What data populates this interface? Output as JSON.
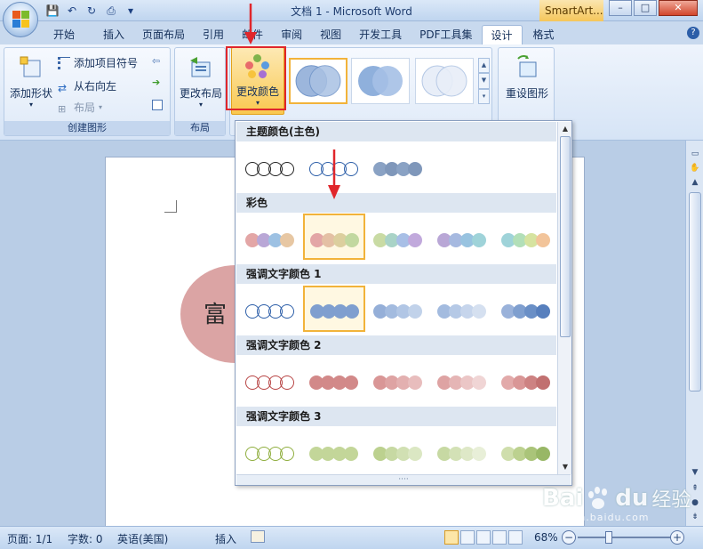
{
  "window": {
    "title": "文档 1 - Microsoft Word",
    "contextual_tab": "SmartArt...",
    "controls": [
      "–",
      "□",
      "✕"
    ]
  },
  "tabs": [
    "开始",
    "插入",
    "页面布局",
    "引用",
    "邮件",
    "审阅",
    "视图",
    "开发工具",
    "PDF工具集",
    "设计",
    "格式"
  ],
  "ribbon": {
    "create_graphic": {
      "label": "创建图形",
      "add_shape": "添加形状",
      "add_bullet": "添加项目符号",
      "right_to_left": "从右向左",
      "layout": "布局"
    },
    "layouts": {
      "label": "布局",
      "change_layout": "更改布局"
    },
    "change_colors": "更改颜色",
    "reset_graphic": "重设图形"
  },
  "dropdown": {
    "sections": [
      "主题颜色(主色)",
      "彩色",
      "强调文字颜色 1",
      "强调文字颜色 2",
      "强调文字颜色 3"
    ]
  },
  "document": {
    "smartart_text": "富"
  },
  "status": {
    "page": "页面: 1/1",
    "words": "字数: 0",
    "language": "英语(美国)",
    "insert_mode": "插入",
    "zoom": "68%"
  },
  "watermark": {
    "brand_a": "Bai",
    "brand_b": "du",
    "brand_c": "经验",
    "url": "jingyan.baidu.com"
  },
  "colors": {
    "highlight_red": "#e0262b",
    "selected_gold": "#f2b33a",
    "smartart_fill": "#dba4a4"
  }
}
